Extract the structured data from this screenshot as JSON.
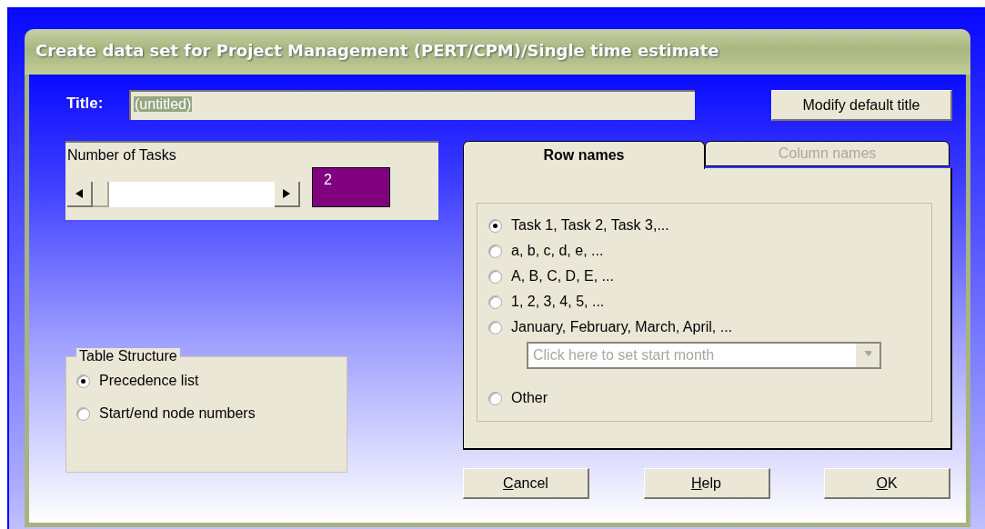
{
  "window": {
    "title": "Create data set for Project Management (PERT/CPM)/Single time estimate"
  },
  "title_field": {
    "label": "Title:",
    "value": "(untitled)",
    "value_selected": true
  },
  "modify_button": {
    "label": "Modify default title"
  },
  "number_of_tasks": {
    "label": "Number of Tasks",
    "level": 0,
    "value": "2"
  },
  "table_structure": {
    "label": "Table Structure",
    "options": [
      {
        "label": "Precedence list",
        "selected": true
      },
      {
        "label": "Start/end node numbers",
        "selected": false
      }
    ]
  },
  "tabs": [
    {
      "label": "Row names",
      "selected": true,
      "disabled": false
    },
    {
      "label": "Column names",
      "selected": false,
      "disabled": true
    }
  ],
  "row_names": {
    "options": [
      {
        "label": "Task 1, Task 2, Task 3,...",
        "selected": true
      },
      {
        "label": "a, b, c, d, e, ...",
        "selected": false
      },
      {
        "label": "A, B, C, D, E, ...",
        "selected": false
      },
      {
        "label": "1, 2, 3, 4, 5, ...",
        "selected": false
      },
      {
        "label": "January, February, March, April, ...",
        "selected": false,
        "dropdown": {
          "value": "Click here to set start month",
          "disabled": true
        }
      },
      {
        "label": "Other",
        "selected": false
      }
    ]
  },
  "buttons": [
    {
      "label": "Cancel",
      "mnemonic": true
    },
    {
      "label": "Help",
      "mnemonic": true
    },
    {
      "label": "OK",
      "mnemonic": true
    }
  ]
}
